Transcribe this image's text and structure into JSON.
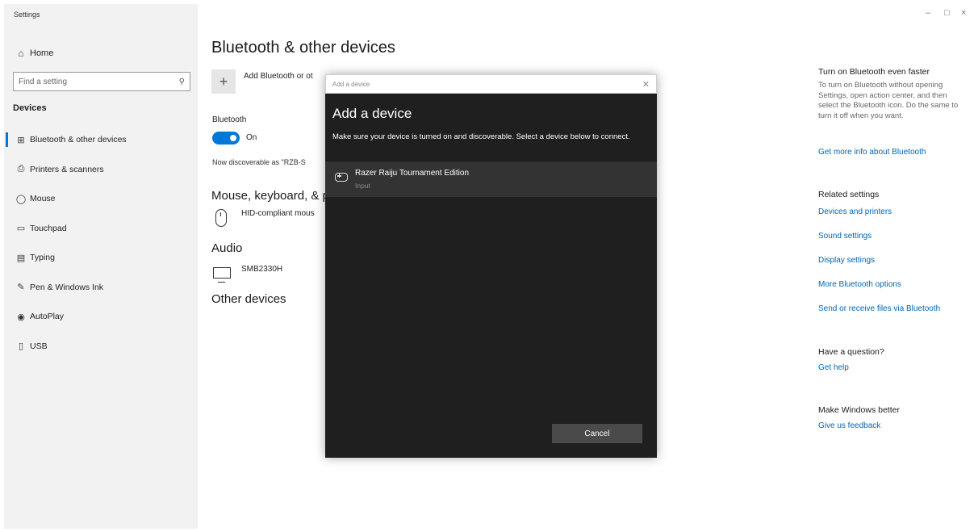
{
  "window": {
    "title": "Settings",
    "controls": {
      "minimize": "–",
      "maximize": "□",
      "close": "×"
    }
  },
  "sidebar": {
    "home_label": "Home",
    "search_placeholder": "Find a setting",
    "section_label": "Devices",
    "items": [
      {
        "label": "Bluetooth & other devices",
        "icon": "bluetooth-devices-icon",
        "glyph": "⊞",
        "active": true
      },
      {
        "label": "Printers & scanners",
        "icon": "printer-icon",
        "glyph": "⎙",
        "active": false
      },
      {
        "label": "Mouse",
        "icon": "mouse-icon",
        "glyph": "◯",
        "active": false
      },
      {
        "label": "Touchpad",
        "icon": "touchpad-icon",
        "glyph": "▭",
        "active": false
      },
      {
        "label": "Typing",
        "icon": "keyboard-icon",
        "glyph": "▤",
        "active": false
      },
      {
        "label": "Pen & Windows Ink",
        "icon": "pen-icon",
        "glyph": "✎",
        "active": false
      },
      {
        "label": "AutoPlay",
        "icon": "autoplay-icon",
        "glyph": "◉",
        "active": false
      },
      {
        "label": "USB",
        "icon": "usb-icon",
        "glyph": "▯",
        "active": false
      }
    ]
  },
  "main": {
    "title": "Bluetooth & other devices",
    "add_device_label": "Add Bluetooth or ot",
    "bluetooth_label": "Bluetooth",
    "bluetooth_state": "On",
    "discoverable_text": "Now discoverable as \"RZB-S",
    "mouse_section": "Mouse, keyboard, & p",
    "mouse_device": "HID-compliant mous",
    "audio_section": "Audio",
    "audio_device": "SMB2330H",
    "other_section": "Other devices"
  },
  "right_panel": {
    "bt_faster_heading": "Turn on Bluetooth even faster",
    "bt_faster_text": "To turn on Bluetooth without opening Settings, open action center, and then select the Bluetooth icon. Do the same to turn it off when you want.",
    "bt_more_info": "Get more info about Bluetooth",
    "related_heading": "Related settings",
    "related_links": [
      "Devices and printers",
      "Sound settings",
      "Display settings",
      "More Bluetooth options",
      "Send or receive files via Bluetooth"
    ],
    "question_heading": "Have a question?",
    "get_help": "Get help",
    "better_heading": "Make Windows better",
    "feedback": "Give us feedback"
  },
  "dialog": {
    "window_title": "Add a device",
    "heading": "Add a device",
    "description": "Make sure your device is turned on and discoverable. Select a device below to connect.",
    "device": {
      "name": "Razer Raiju Tournament Edition",
      "type": "Input",
      "icon": "gamepad-icon"
    },
    "cancel_label": "Cancel"
  }
}
